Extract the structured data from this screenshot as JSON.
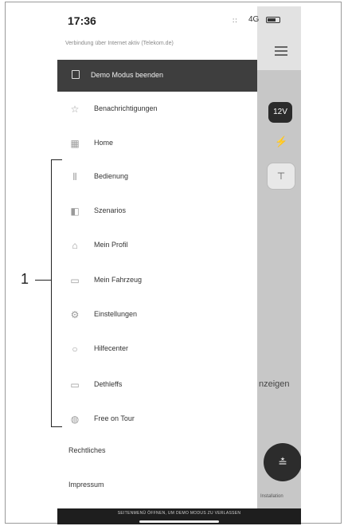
{
  "status_bar": {
    "time": "17:36",
    "signal": "::",
    "network": "4G"
  },
  "connection_notice": "Verbindung über Internet aktiv (Telekom.de)",
  "demo_bar": {
    "label": "Demo Modus beenden",
    "icon": "exit-icon"
  },
  "menu": [
    {
      "label": "Benachrichtigungen",
      "icon": "bell-icon",
      "glyph": "☆"
    },
    {
      "label": "Home",
      "icon": "grid-icon",
      "glyph": "▦"
    },
    {
      "label": "Bedienung",
      "icon": "sliders-icon",
      "glyph": "⫴"
    },
    {
      "label": "Szenarios",
      "icon": "scenario-icon",
      "glyph": "◧"
    },
    {
      "label": "Mein Profil",
      "icon": "person-icon",
      "glyph": "⌂"
    },
    {
      "label": "Mein Fahrzeug",
      "icon": "vehicle-icon",
      "glyph": "▭"
    },
    {
      "label": "Einstellungen",
      "icon": "gear-icon",
      "glyph": "⚙"
    },
    {
      "label": "Hilfecenter",
      "icon": "help-icon",
      "glyph": "○"
    },
    {
      "label": "Dethleffs",
      "icon": "brand-icon",
      "glyph": "▭"
    },
    {
      "label": "Free on Tour",
      "icon": "globe-icon",
      "glyph": "◍"
    }
  ],
  "legal": {
    "rechtliches": "Rechtliches",
    "impressum": "Impressum"
  },
  "footer_text": "SEITENMENÜ ÖFFNEN, UM DEMO MODUS ZU VERLASSEN",
  "background": {
    "badge": "12V",
    "label": "nzeigen",
    "fab_small": "Installation"
  },
  "callout": {
    "number": "1"
  }
}
